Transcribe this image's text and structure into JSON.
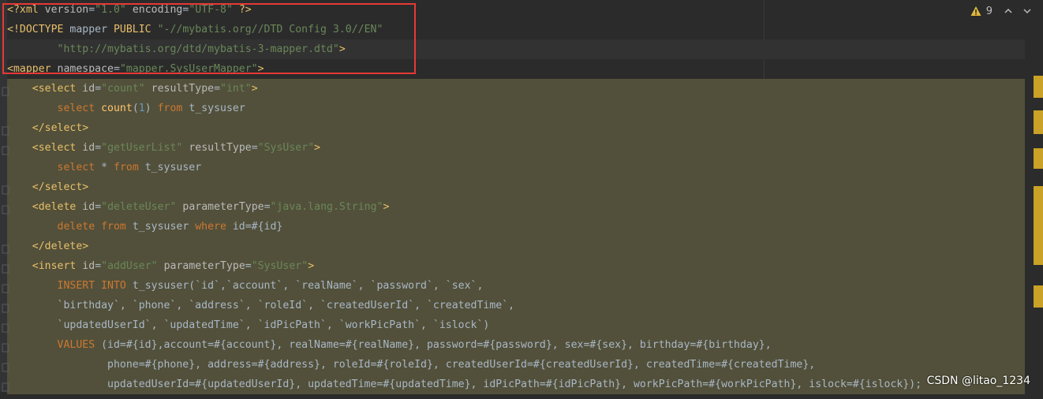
{
  "inspection": {
    "warning_count": "9"
  },
  "watermark": "CSDN @litao_1234",
  "colors": {
    "tag": "#e8bf6a",
    "string": "#6a8759",
    "keyword": "#cc7832",
    "function": "#ffc66d",
    "number": "#6897bb",
    "highlight": "#52503a",
    "annotation_box": "#e53935"
  },
  "lines": [
    [
      [
        "tag",
        "<?xml "
      ],
      [
        "attr",
        "version"
      ],
      [
        "plain",
        "="
      ],
      [
        "str",
        "\"1.0\""
      ],
      [
        "plain",
        " "
      ],
      [
        "attr",
        "encoding"
      ],
      [
        "plain",
        "="
      ],
      [
        "str",
        "\"UTF-8\""
      ],
      [
        "tag",
        " ?>"
      ]
    ],
    [
      [
        "tag",
        "<!DOCTYPE "
      ],
      [
        "plain",
        "mapper "
      ],
      [
        "tag",
        "PUBLIC "
      ],
      [
        "str",
        "\"-//mybatis.org//DTD Config 3.0//EN\""
      ]
    ],
    [
      [
        "plain",
        "        "
      ],
      [
        "str",
        "\"http://mybatis.org/dtd/mybatis-3-mapper.dtd\""
      ],
      [
        "tag",
        ">"
      ]
    ],
    [
      [
        "tag",
        "<mapper "
      ],
      [
        "attr",
        "namespace"
      ],
      [
        "plain",
        "="
      ],
      [
        "str",
        "\"mapper.SysUserMapper\""
      ],
      [
        "tag",
        ">"
      ]
    ],
    [
      [
        "plain",
        "    "
      ],
      [
        "tag",
        "<select "
      ],
      [
        "attr",
        "id"
      ],
      [
        "plain",
        "="
      ],
      [
        "str",
        "\"count\""
      ],
      [
        "plain",
        " "
      ],
      [
        "attr",
        "resultType"
      ],
      [
        "plain",
        "="
      ],
      [
        "str",
        "\"int\""
      ],
      [
        "tag",
        ">"
      ]
    ],
    [
      [
        "plain",
        "        "
      ],
      [
        "kw",
        "select "
      ],
      [
        "fn",
        "count"
      ],
      [
        "plain",
        "("
      ],
      [
        "num",
        "1"
      ],
      [
        "plain",
        ") "
      ],
      [
        "kw",
        "from "
      ],
      [
        "plain",
        "t_sysuser"
      ]
    ],
    [
      [
        "plain",
        "    "
      ],
      [
        "tag",
        "</select>"
      ]
    ],
    [
      [
        "plain",
        "    "
      ],
      [
        "tag",
        "<select "
      ],
      [
        "attr",
        "id"
      ],
      [
        "plain",
        "="
      ],
      [
        "str",
        "\"getUserList\""
      ],
      [
        "plain",
        " "
      ],
      [
        "attr",
        "resultType"
      ],
      [
        "plain",
        "="
      ],
      [
        "str",
        "\"SysUser\""
      ],
      [
        "tag",
        ">"
      ]
    ],
    [
      [
        "plain",
        "        "
      ],
      [
        "kw",
        "select "
      ],
      [
        "plain",
        "* "
      ],
      [
        "kw",
        "from "
      ],
      [
        "plain",
        "t_sysuser"
      ]
    ],
    [
      [
        "plain",
        "    "
      ],
      [
        "tag",
        "</select>"
      ]
    ],
    [
      [
        "plain",
        "    "
      ],
      [
        "tag",
        "<delete "
      ],
      [
        "attr",
        "id"
      ],
      [
        "plain",
        "="
      ],
      [
        "str",
        "\"deleteUser\""
      ],
      [
        "plain",
        " "
      ],
      [
        "attr",
        "parameterType"
      ],
      [
        "plain",
        "="
      ],
      [
        "str",
        "\"java.lang.String\""
      ],
      [
        "tag",
        ">"
      ]
    ],
    [
      [
        "plain",
        "        "
      ],
      [
        "kw",
        "delete from "
      ],
      [
        "plain",
        "t_sysuser "
      ],
      [
        "kw",
        "where "
      ],
      [
        "plain",
        "id=#{id}"
      ]
    ],
    [
      [
        "plain",
        "    "
      ],
      [
        "tag",
        "</delete>"
      ]
    ],
    [
      [
        "plain",
        "    "
      ],
      [
        "tag",
        "<insert "
      ],
      [
        "attr",
        "id"
      ],
      [
        "plain",
        "="
      ],
      [
        "str",
        "\"addUser\""
      ],
      [
        "plain",
        " "
      ],
      [
        "attr",
        "parameterType"
      ],
      [
        "plain",
        "="
      ],
      [
        "str",
        "\"SysUser\""
      ],
      [
        "tag",
        ">"
      ]
    ],
    [
      [
        "plain",
        "        "
      ],
      [
        "kw",
        "INSERT INTO "
      ],
      [
        "plain",
        "t_sysuser(`id`,`account`, `realName`, `password`, `sex`,"
      ]
    ],
    [
      [
        "plain",
        "        `birthday`, `phone`, `address`, `roleId`, `createdUserId`, `createdTime`,"
      ]
    ],
    [
      [
        "plain",
        "        `updatedUserId`, `updatedTime`, `idPicPath`, `workPicPath`, `islock`)"
      ]
    ],
    [
      [
        "plain",
        "        "
      ],
      [
        "kw",
        "VALUES "
      ],
      [
        "plain",
        "(id=#{id},account=#{account}, realName=#{realName}, password=#{password}, sex=#{sex}, birthday=#{birthday},"
      ]
    ],
    [
      [
        "plain",
        "                phone=#{phone}, address=#{address}, roleId=#{roleId}, createdUserId=#{createdUserId}, createdTime=#{createdTime},"
      ]
    ],
    [
      [
        "plain",
        "                updatedUserId=#{updatedUserId}, updatedTime=#{updatedTime}, idPicPath=#{idPicPath}, workPicPath=#{workPicPath}, islock=#{islock});"
      ]
    ]
  ]
}
